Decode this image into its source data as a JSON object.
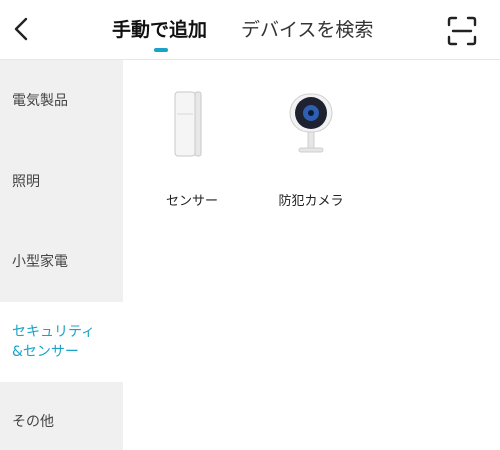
{
  "header": {
    "tab_manual": "手動で追加",
    "tab_search": "デバイスを検索"
  },
  "sidebar": {
    "items": [
      {
        "label": "電気製品"
      },
      {
        "label": "照明"
      },
      {
        "label": "小型家電"
      },
      {
        "label_line1": "セキュリティ",
        "label_line2": "&センサー"
      },
      {
        "label": "その他"
      }
    ],
    "active_index": 3
  },
  "devices": [
    {
      "label": "センサー",
      "icon": "door-sensor-icon"
    },
    {
      "label": "防犯カメラ",
      "icon": "security-camera-icon"
    }
  ],
  "colors": {
    "accent": "#1aa3c8",
    "sidebar_bg": "#f0f0f0",
    "text_primary": "#111111",
    "text_secondary": "#444444"
  }
}
